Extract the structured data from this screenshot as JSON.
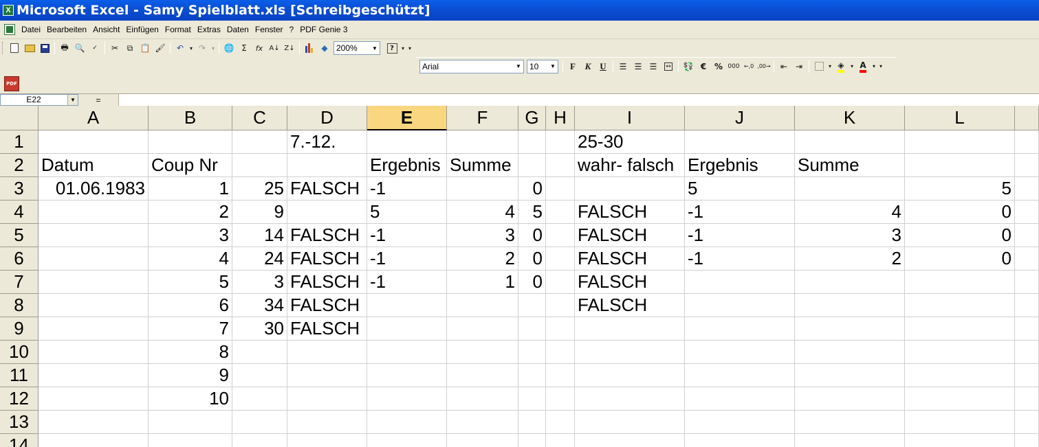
{
  "window": {
    "title": "Microsoft Excel - Samy Spielblatt.xls  [Schreibgeschützt]",
    "app_icon": "excel-icon"
  },
  "menu": [
    "Datei",
    "Bearbeiten",
    "Ansicht",
    "Einfügen",
    "Format",
    "Extras",
    "Daten",
    "Fenster",
    "?",
    "PDF Genie 3"
  ],
  "toolbar": {
    "zoom": "200%",
    "sigma": "Σ",
    "fx": "fx",
    "sort_az": "A↓",
    "sort_za": "Z↓"
  },
  "format_toolbar": {
    "font": "Arial",
    "size": "10",
    "bold": "F",
    "italic": "K",
    "underline": "U",
    "euro": "€",
    "percent": "%",
    "thousands": "000",
    "font_color_letter": "A"
  },
  "pdf_toolbar": {
    "label": "PDF"
  },
  "formula_bar": {
    "cell_ref": "E22",
    "fx": "=",
    "formula": ""
  },
  "columns": [
    "A",
    "B",
    "C",
    "D",
    "E",
    "F",
    "G",
    "H",
    "I",
    "J",
    "K",
    "L"
  ],
  "active_column": "E",
  "rows": [
    "1",
    "2",
    "3",
    "4",
    "5",
    "6",
    "7",
    "8",
    "9",
    "10",
    "11",
    "12",
    "13",
    "14"
  ],
  "cells": {
    "D1": "7.-12.",
    "I1": "25-30",
    "A2": "Datum",
    "B2": "Coup Nr",
    "E2": "Ergebnis",
    "F2": "Summe",
    "I2": "wahr- falsch",
    "J2": "Ergebnis",
    "K2": "Summe",
    "A3": "01.06.1983",
    "B3": "1",
    "C3": "25",
    "D3": "FALSCH",
    "E3": "-1",
    "G3": "0",
    "J3": "5",
    "L3": "5",
    "B4": "2",
    "C4": "9",
    "E4": "5",
    "F4": "4",
    "G4": "5",
    "I4": "FALSCH",
    "J4": "-1",
    "K4": "4",
    "L4": "0",
    "B5": "3",
    "C5": "14",
    "D5": "FALSCH",
    "E5": "-1",
    "F5": "3",
    "G5": "0",
    "I5": "FALSCH",
    "J5": "-1",
    "K5": "3",
    "L5": "0",
    "B6": "4",
    "C6": "24",
    "D6": "FALSCH",
    "E6": "-1",
    "F6": "2",
    "G6": "0",
    "I6": "FALSCH",
    "J6": "-1",
    "K6": "2",
    "L6": "0",
    "B7": "5",
    "C7": "3",
    "D7": "FALSCH",
    "E7": "-1",
    "F7": "1",
    "G7": "0",
    "I7": "FALSCH",
    "B8": "6",
    "C8": "34",
    "D8": "FALSCH",
    "I8": "FALSCH",
    "B9": "7",
    "C9": "30",
    "D9": "FALSCH",
    "B10": "8",
    "B11": "9",
    "B12": "10"
  }
}
